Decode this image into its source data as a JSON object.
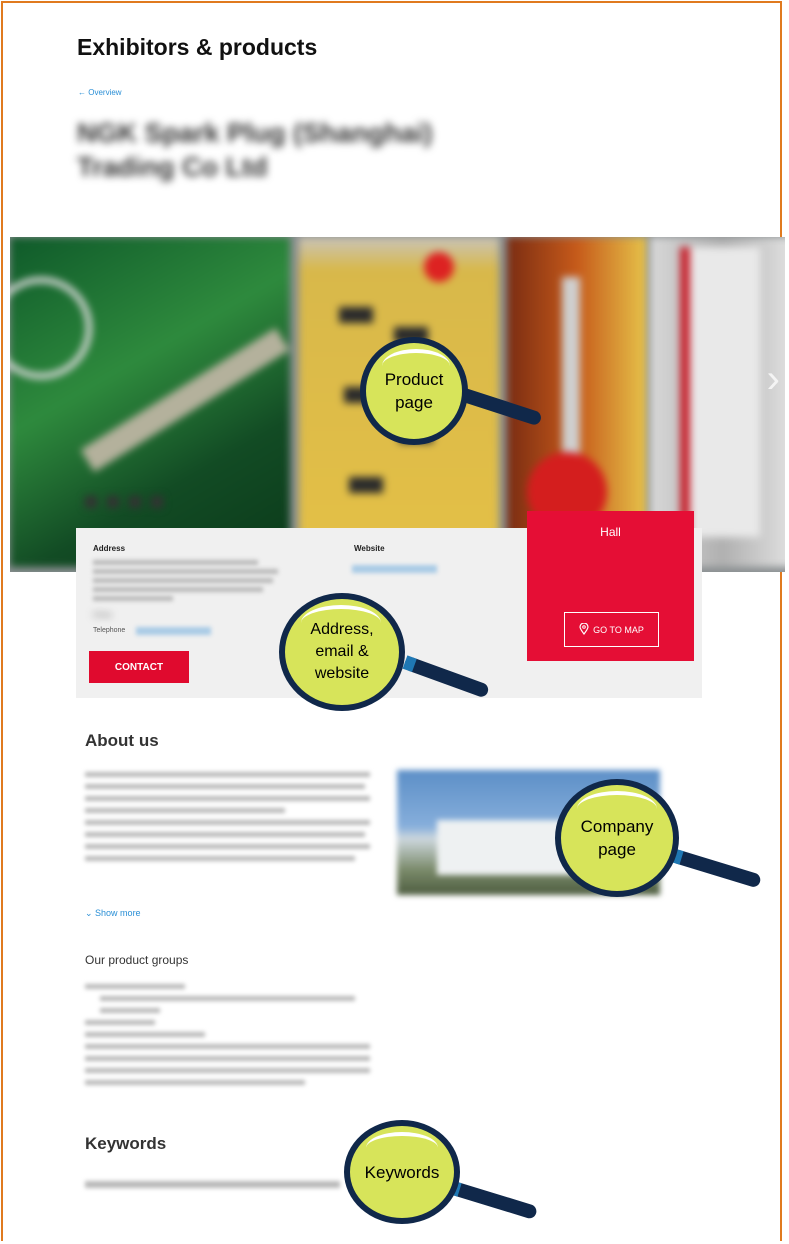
{
  "header": {
    "title": "Exhibitors & products",
    "back_label": "Overview"
  },
  "exhibitor": {
    "name": "NGK Spark Plug (Shanghai) Trading Co Ltd"
  },
  "contact": {
    "address_label": "Address",
    "country": "China",
    "telephone_label": "Telephone",
    "website_label": "Website",
    "contact_button": "CONTACT"
  },
  "hall": {
    "title": "Hall",
    "map_button": "GO TO MAP"
  },
  "about": {
    "heading": "About us",
    "show_more": "Show more"
  },
  "product_groups": {
    "title": "Our product groups"
  },
  "keywords": {
    "heading": "Keywords"
  },
  "callouts": {
    "product": "Product page",
    "address": "Address, email & website",
    "company": "Company page",
    "keywords": "Keywords"
  },
  "colors": {
    "accent_red": "#e50e35",
    "link_blue": "#2a8fd6",
    "frame_orange": "#e07a1f",
    "lens_green": "#d7e45a",
    "lens_navy": "#10284a"
  }
}
